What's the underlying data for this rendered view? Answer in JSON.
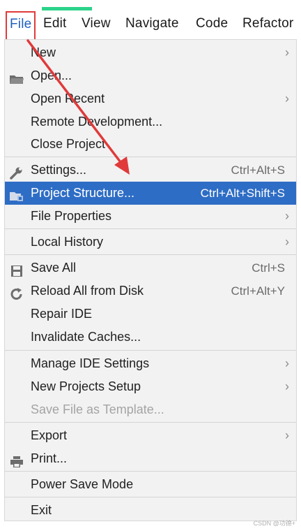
{
  "menubar": {
    "file": "File",
    "edit": "Edit",
    "view": "View",
    "navigate": "Navigate",
    "code": "Code",
    "refactor": "Refactor"
  },
  "menu": {
    "items": [
      {
        "label": "New",
        "submenu": true
      },
      {
        "label": "Open...",
        "icon": "folder-icon"
      },
      {
        "label": "Open Recent",
        "submenu": true
      },
      {
        "label": "Remote Development..."
      },
      {
        "label": "Close Project"
      },
      {
        "label": "Settings...",
        "shortcut": "Ctrl+Alt+S",
        "icon": "wrench-icon"
      },
      {
        "label": "Project Structure...",
        "shortcut": "Ctrl+Alt+Shift+S",
        "icon": "project-structure-icon",
        "selected": true
      },
      {
        "label": "File Properties",
        "submenu": true
      },
      {
        "label": "Local History",
        "submenu": true
      },
      {
        "label": "Save All",
        "shortcut": "Ctrl+S",
        "icon": "save-icon"
      },
      {
        "label": "Reload All from Disk",
        "shortcut": "Ctrl+Alt+Y",
        "icon": "reload-icon"
      },
      {
        "label": "Repair IDE"
      },
      {
        "label": "Invalidate Caches..."
      },
      {
        "label": "Manage IDE Settings",
        "submenu": true
      },
      {
        "label": "New Projects Setup",
        "submenu": true
      },
      {
        "label": "Save File as Template...",
        "disabled": true
      },
      {
        "label": "Export",
        "submenu": true
      },
      {
        "label": "Print...",
        "icon": "printer-icon"
      },
      {
        "label": "Power Save Mode"
      },
      {
        "label": "Exit"
      }
    ]
  },
  "arrow_char": "›",
  "colors": {
    "selection": "#2e6dc5",
    "highlight_box": "#e03a3a",
    "annotation_arrow": "#e03a3a",
    "accent_strip": "#2bd38a"
  },
  "watermark": "CSDN @功德+"
}
